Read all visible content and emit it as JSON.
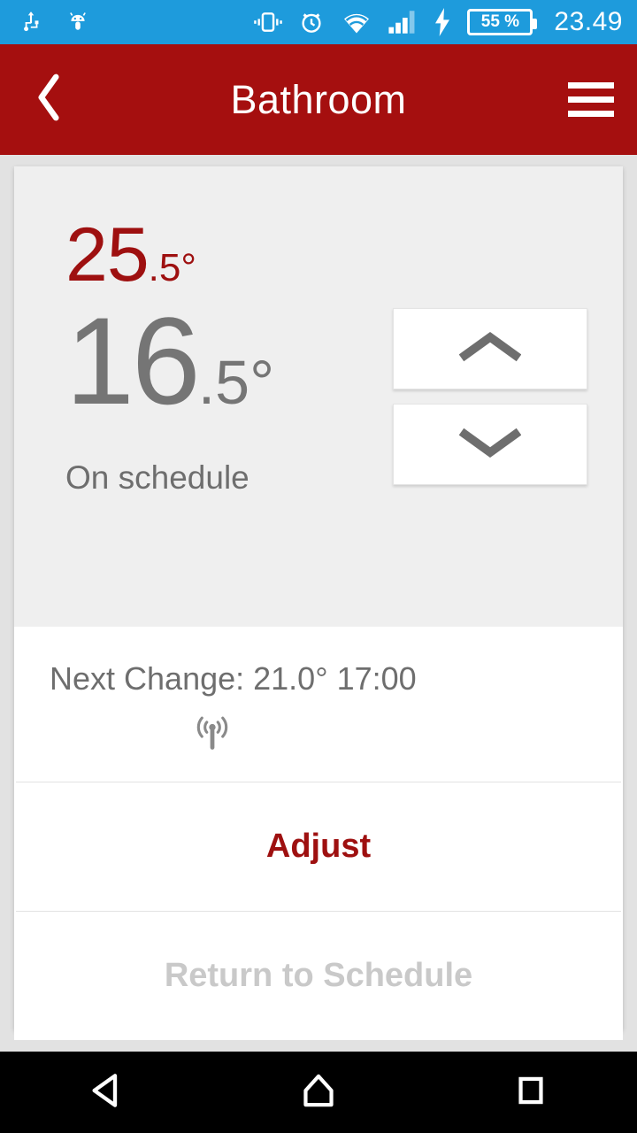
{
  "status_bar": {
    "icons_left": [
      "usb-icon",
      "android-debug-icon"
    ],
    "icons_right": [
      "vibrate-icon",
      "alarm-icon",
      "wifi-icon",
      "cellular-signal-icon",
      "charging-bolt-icon"
    ],
    "battery_level": "55 %",
    "time": "23.49",
    "background_color": "#1e9bdc"
  },
  "app_bar": {
    "title": "Bathroom",
    "back_icon": "chevron-left-icon",
    "menu_icon": "hamburger-menu-icon",
    "background_color": "#a50f0f"
  },
  "thermostat": {
    "current_temperature": {
      "whole": "25",
      "fraction": ".5°",
      "color": "#9e1010"
    },
    "target_temperature": {
      "whole": "16",
      "fraction": ".5°",
      "color": "#757575"
    },
    "status": "On schedule",
    "increase_icon": "chevron-up-icon",
    "decrease_icon": "chevron-down-icon",
    "panel_color": "#efefef"
  },
  "next_change": {
    "text": "Next Change: 21.0° 17:00",
    "signal_icon": "broadcast-antenna-icon"
  },
  "actions": [
    {
      "label": "Adjust",
      "state": "enabled",
      "color": "#9e1010"
    },
    {
      "label": "Return to Schedule",
      "state": "disabled",
      "color": "#c9c9c9"
    }
  ],
  "navigation_bar": {
    "back_icon": "triangle-back-icon",
    "home_icon": "home-icon",
    "recents_icon": "square-recents-icon"
  }
}
